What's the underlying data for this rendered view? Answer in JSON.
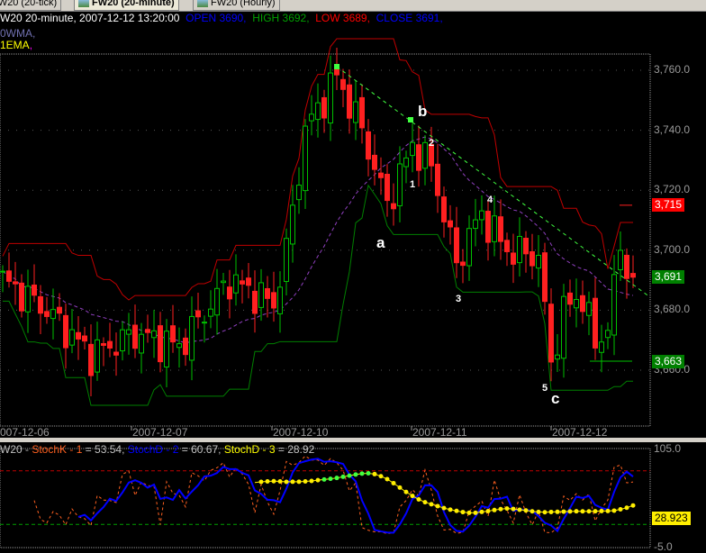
{
  "tabs": [
    {
      "label": "FW20 (20-tick)"
    },
    {
      "label": "FW20 (20-minute)"
    },
    {
      "label": "FW20 (Hourly)"
    }
  ],
  "header": {
    "title": "W20 20-minute, 2007-12-12 13:20:00",
    "open": "OPEN 3690,",
    "high": "HIGH 3692,",
    "low": "LOW 3689,",
    "close": "CLOSE 3691,",
    "line2": "0WMA,",
    "line3": "1EMA"
  },
  "price_axis": [
    "3,760.0",
    "3,740.0",
    "3,720.0",
    "3,700.0",
    "3,680.0",
    "3,660.0"
  ],
  "price_tags": {
    "red": "3,715",
    "last": "3,691",
    "green": "3,663"
  },
  "dates": [
    "007-12-06",
    "2007-12-07",
    "2007-12-10",
    "2007-12-11",
    "2007-12-12"
  ],
  "annotations": {
    "a": "a",
    "b": "b",
    "c": "c",
    "w1": "1",
    "w2": "2",
    "w3": "3",
    "w4": "4",
    "w5": "5"
  },
  "stoch": {
    "prefix": "W20 - ",
    "k_name": "StochK - 1",
    "k_val": " = 53.54, ",
    "d_name": "StochD - 2",
    "d_val": " = 60.67, ",
    "d3_name": "StochD - 3",
    "d3_val": " = 28.92",
    "ymax": "105.0",
    "ymin": "-5.0",
    "last": "28.923"
  },
  "chart_data": {
    "type": "candlestick",
    "price_range": [
      3645,
      3765
    ],
    "close_waypoints": [
      [
        0,
        3690
      ],
      [
        7,
        3680
      ],
      [
        14,
        3665
      ],
      [
        21,
        3672
      ],
      [
        28,
        3668
      ],
      [
        36,
        3690
      ],
      [
        43,
        3682
      ],
      [
        45,
        3700
      ],
      [
        48,
        3740
      ],
      [
        53,
        3758
      ],
      [
        57,
        3740
      ],
      [
        61,
        3715
      ],
      [
        65,
        3735
      ],
      [
        68,
        3728
      ],
      [
        70,
        3712
      ],
      [
        72,
        3695
      ],
      [
        74,
        3705
      ],
      [
        76,
        3712
      ],
      [
        80,
        3700
      ],
      [
        85,
        3698
      ],
      [
        87,
        3662
      ],
      [
        89,
        3680
      ],
      [
        92,
        3685
      ],
      [
        94,
        3668
      ],
      [
        96,
        3675
      ],
      [
        98,
        3700
      ],
      [
        100,
        3691
      ]
    ],
    "stoch_range": [
      -5,
      105
    ],
    "stoch_levels": [
      80,
      20
    ]
  }
}
